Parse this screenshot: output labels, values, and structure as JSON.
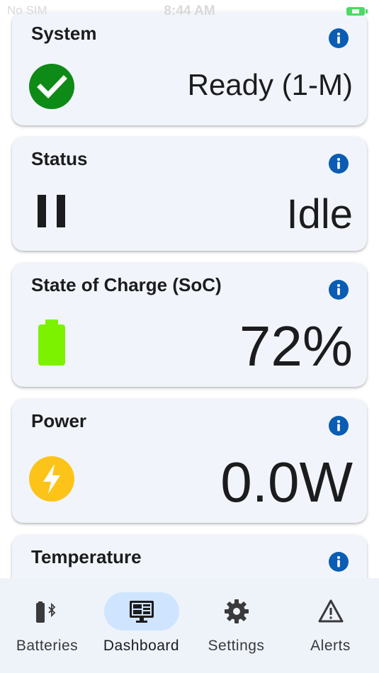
{
  "status_bar": {
    "carrier": "No SIM",
    "time": "8:44 AM"
  },
  "cards": [
    {
      "title": "System",
      "value": "Ready (1-M)",
      "icon": "check-circle-icon"
    },
    {
      "title": "Status",
      "value": "Idle",
      "icon": "pause-icon"
    },
    {
      "title": "State of Charge (SoC)",
      "value": "72%",
      "icon": "battery-icon"
    },
    {
      "title": "Power",
      "value": "0.0W",
      "icon": "lightning-icon"
    },
    {
      "title": "Temperature",
      "value": "",
      "icon": ""
    }
  ],
  "tabs": [
    {
      "label": "Batteries",
      "icon": "bluetooth-battery-icon"
    },
    {
      "label": "Dashboard",
      "icon": "monitor-dashboard-icon",
      "active": true
    },
    {
      "label": "Settings",
      "icon": "gear-icon"
    },
    {
      "label": "Alerts",
      "icon": "warning-icon"
    }
  ],
  "colors": {
    "card_bg": "#f1f5fb",
    "info_blue": "#0a5db3",
    "success_green": "#0e8a16",
    "battery_green": "#7cf200",
    "power_yellow": "#fcc419",
    "active_tab_pill": "#cfe4ff"
  }
}
